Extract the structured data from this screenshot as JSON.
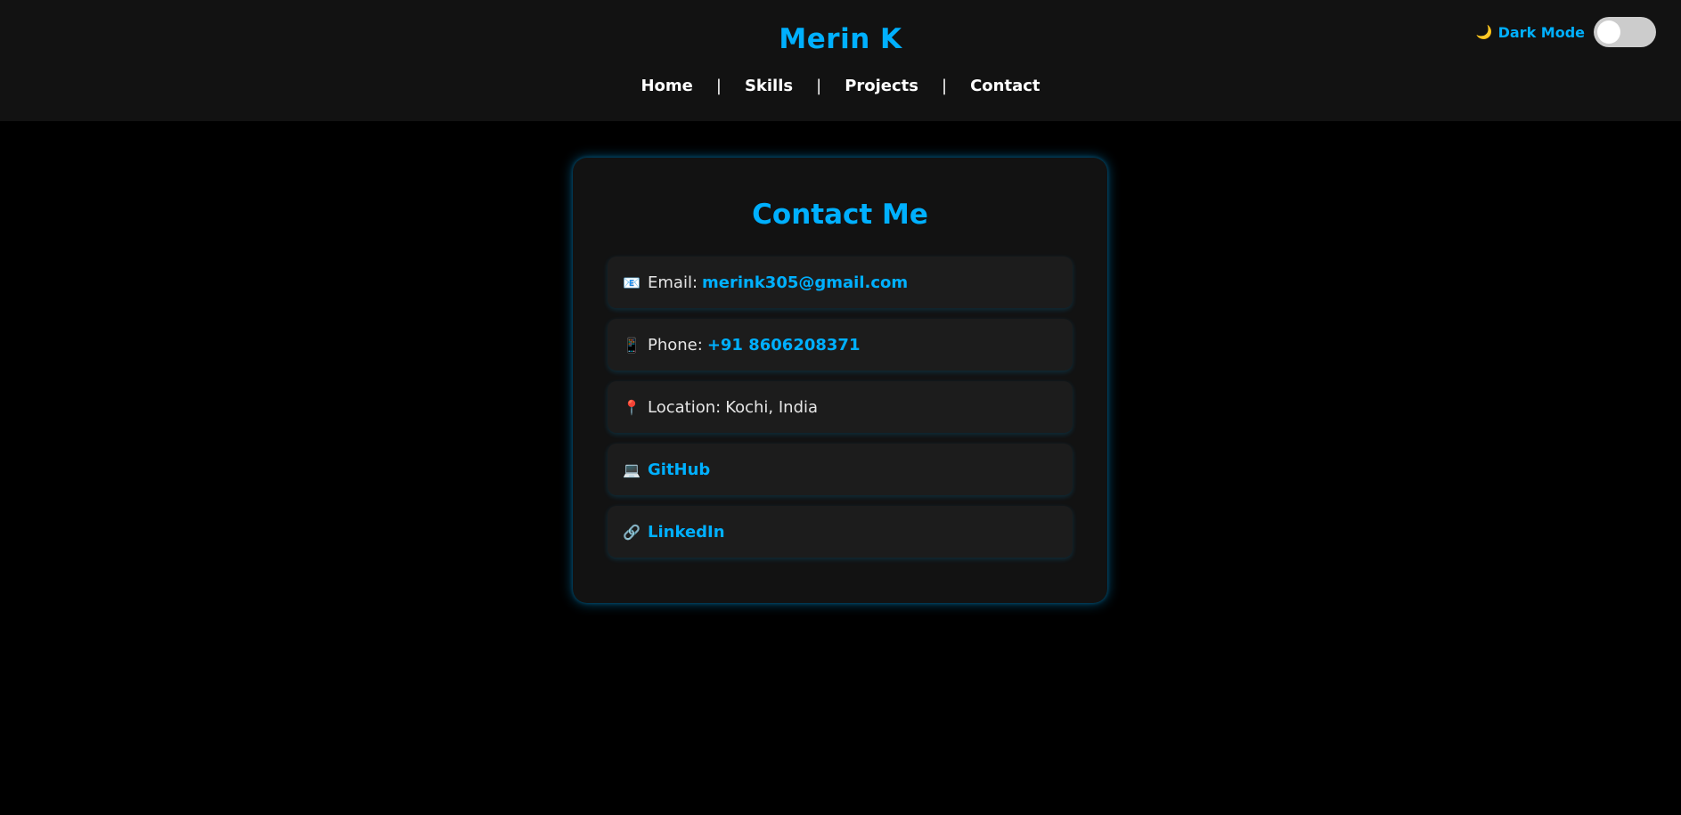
{
  "header": {
    "title": "Merin K",
    "nav": {
      "home": "Home",
      "skills": "Skills",
      "projects": "Projects",
      "contact": "Contact",
      "separator": "|"
    },
    "theme_toggle": {
      "icon": "🌙",
      "label": "Dark Mode",
      "enabled": false
    }
  },
  "contact": {
    "title": "Contact Me",
    "items": [
      {
        "icon": "📧",
        "icon_name": "email-icon",
        "label": "Email:",
        "value": "merink305@gmail.com",
        "is_link": true
      },
      {
        "icon": "📱",
        "icon_name": "phone-icon",
        "label": "Phone:",
        "value": "+91 8606208371",
        "is_link": true
      },
      {
        "icon": "📍",
        "icon_name": "location-pin-icon",
        "label": "Location:",
        "value": "Kochi, India",
        "is_link": false
      },
      {
        "icon": "💻",
        "icon_name": "laptop-icon",
        "label": "",
        "value": "GitHub",
        "is_link": true
      },
      {
        "icon": "🔗",
        "icon_name": "link-icon",
        "label": "",
        "value": "LinkedIn",
        "is_link": true
      }
    ]
  },
  "colors": {
    "accent": "#00b0ff",
    "background": "#000000",
    "header_bg": "#121212",
    "card_bg": "#121212",
    "item_bg": "#1c1c1c"
  }
}
